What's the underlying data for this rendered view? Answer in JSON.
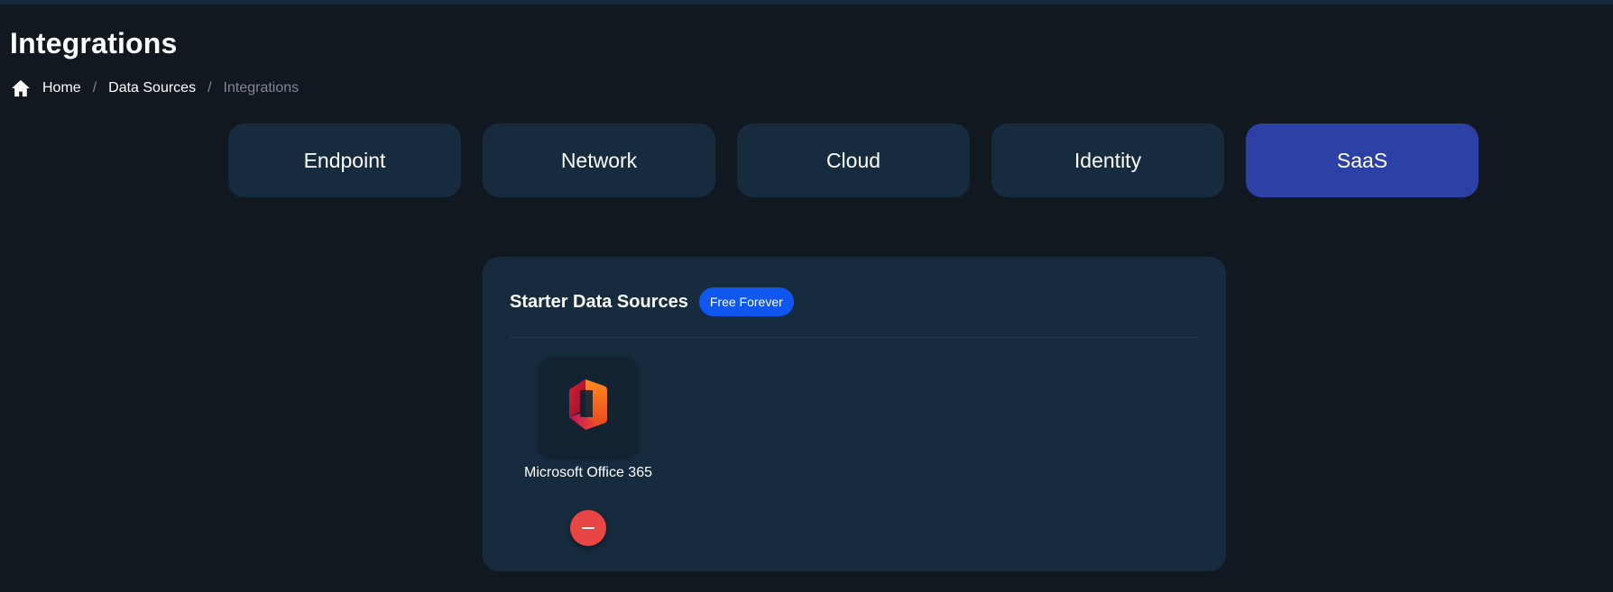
{
  "page": {
    "title": "Integrations"
  },
  "breadcrumb": {
    "home_icon": "home-icon",
    "items": [
      "Home",
      "Data Sources",
      "Integrations"
    ],
    "separator": "/"
  },
  "tabs": [
    {
      "label": "Endpoint",
      "active": false
    },
    {
      "label": "Network",
      "active": false
    },
    {
      "label": "Cloud",
      "active": false
    },
    {
      "label": "Identity",
      "active": false
    },
    {
      "label": "SaaS",
      "active": true
    }
  ],
  "section": {
    "title": "Starter Data Sources",
    "badge": "Free Forever",
    "items": [
      {
        "label": "Microsoft Office 365",
        "icon": "microsoft-office-365-logo-icon",
        "action_icon": "minus-icon"
      }
    ]
  },
  "colors": {
    "background": "#111820",
    "tab": "#172b3f",
    "tab_active": "#2c40a6",
    "badge": "#0f57ee",
    "remove": "#e84545"
  }
}
